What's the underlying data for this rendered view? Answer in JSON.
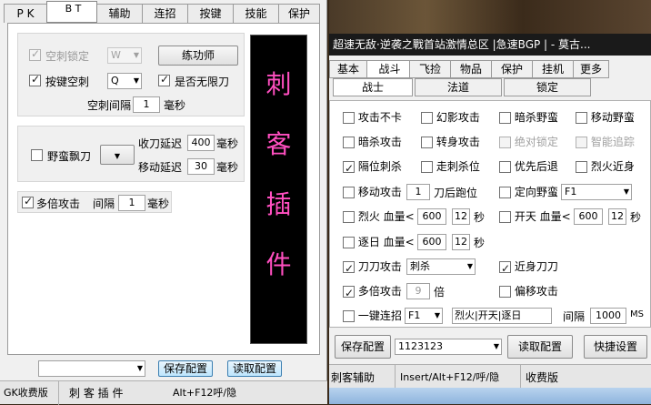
{
  "left": {
    "tabs": [
      "P K",
      "B T",
      "辅助",
      "连招",
      "按键",
      "技能",
      "保护"
    ],
    "selected_tab": "B T",
    "group1": {
      "kongci_lock": {
        "label": "空刺锁定",
        "checked": true,
        "disabled": true,
        "key": "W"
      },
      "practice_button": "练功师",
      "key_kongci": {
        "label": "按键空刺",
        "checked": true,
        "key": "Q"
      },
      "unlimited_knife": {
        "label": "是否无限刀",
        "checked": true
      },
      "interval_label": "空刺间隔",
      "interval_value": "1",
      "interval_unit": "毫秒"
    },
    "group2": {
      "wild_drift": {
        "label": "野蛮飘刀",
        "checked": false
      },
      "collect_delay_label": "收刀延迟",
      "collect_delay_value": "400",
      "collect_delay_unit": "毫秒",
      "move_delay_label": "移动延迟",
      "move_delay_value": "30",
      "move_delay_unit": "毫秒"
    },
    "multi_attack": {
      "label": "多倍攻击",
      "checked": true,
      "interval_label": "间隔",
      "interval_value": "1",
      "interval_unit": "毫秒"
    },
    "banner": [
      "刺",
      "客",
      "插",
      "件"
    ],
    "bottom": {
      "config_select": "",
      "save_button": "保存配置",
      "load_button": "读取配置"
    },
    "status": {
      "edition": "GK收费版",
      "name": "刺 客 插 件",
      "hotkey": "Alt+F12呼/隐"
    }
  },
  "right": {
    "title": "超速无敌·逆袭之戰首站激情总区 |急速BGP | - 莫古...",
    "tabs": [
      "基本",
      "战斗",
      "飞捡",
      "物品",
      "保护",
      "挂机",
      "更多"
    ],
    "selected_tab": "战斗",
    "subtabs": [
      "战士",
      "法道",
      "锁定"
    ],
    "rows": {
      "r1": [
        {
          "label": "攻击不卡",
          "checked": false
        },
        {
          "label": "幻影攻击",
          "checked": false
        },
        {
          "label": "暗杀野蛮",
          "checked": false
        },
        {
          "label": "移动野蛮",
          "checked": false
        }
      ],
      "r2": [
        {
          "label": "暗杀攻击",
          "checked": false
        },
        {
          "label": "转身攻击",
          "checked": false
        },
        {
          "label": "绝对锁定",
          "checked": false,
          "disabled": true
        },
        {
          "label": "智能追踪",
          "checked": false,
          "disabled": true
        }
      ],
      "r3": [
        {
          "label": "隔位刺杀",
          "checked": true
        },
        {
          "label": "走刺杀位",
          "checked": false
        },
        {
          "label": "优先后退",
          "checked": false
        },
        {
          "label": "烈火近身",
          "checked": false
        }
      ],
      "r4": {
        "move_attack": "移动攻击",
        "move_value": "1",
        "move_unit": "刀后跑位",
        "fixed_wild": "定向野蛮",
        "fixed_key": "F1"
      },
      "r5": {
        "liehuo": "烈火",
        "hp_label": "血量<",
        "hp_value": "600",
        "sec_value": "12",
        "sec_unit": "秒",
        "kaitian": "开天",
        "hp2_label": "血量<",
        "hp2_value": "600",
        "sec2_value": "12",
        "sec2_unit": "秒"
      },
      "r6": {
        "zhuri": "逐日",
        "hp_label": "血量<",
        "hp_value": "600",
        "sec_value": "12",
        "sec_unit": "秒"
      },
      "r7": {
        "blade": "刀刀攻击",
        "blade_checked": true,
        "blade_select": "刺杀",
        "near_blade": "近身刀刀",
        "near_checked": true
      },
      "r8": {
        "multi": "多倍攻击",
        "multi_checked": true,
        "multi_value": "9",
        "multi_unit": "倍",
        "offset": "偏移攻击",
        "offset_checked": false
      },
      "r9": {
        "combo": "一键连招",
        "combo_key": "F1",
        "combo_text": "烈火|开天|逐日",
        "interval": "间隔",
        "interval_value": "1000",
        "interval_unit": "MS"
      }
    },
    "bottom": {
      "save_button": "保存配置",
      "config_value": "1123123",
      "load_button": "读取配置",
      "quick_button": "快捷设置"
    },
    "status": {
      "name": "刺客辅助",
      "hotkey": "Insert/Alt+F12/呼/隐",
      "edition": "收费版"
    }
  }
}
